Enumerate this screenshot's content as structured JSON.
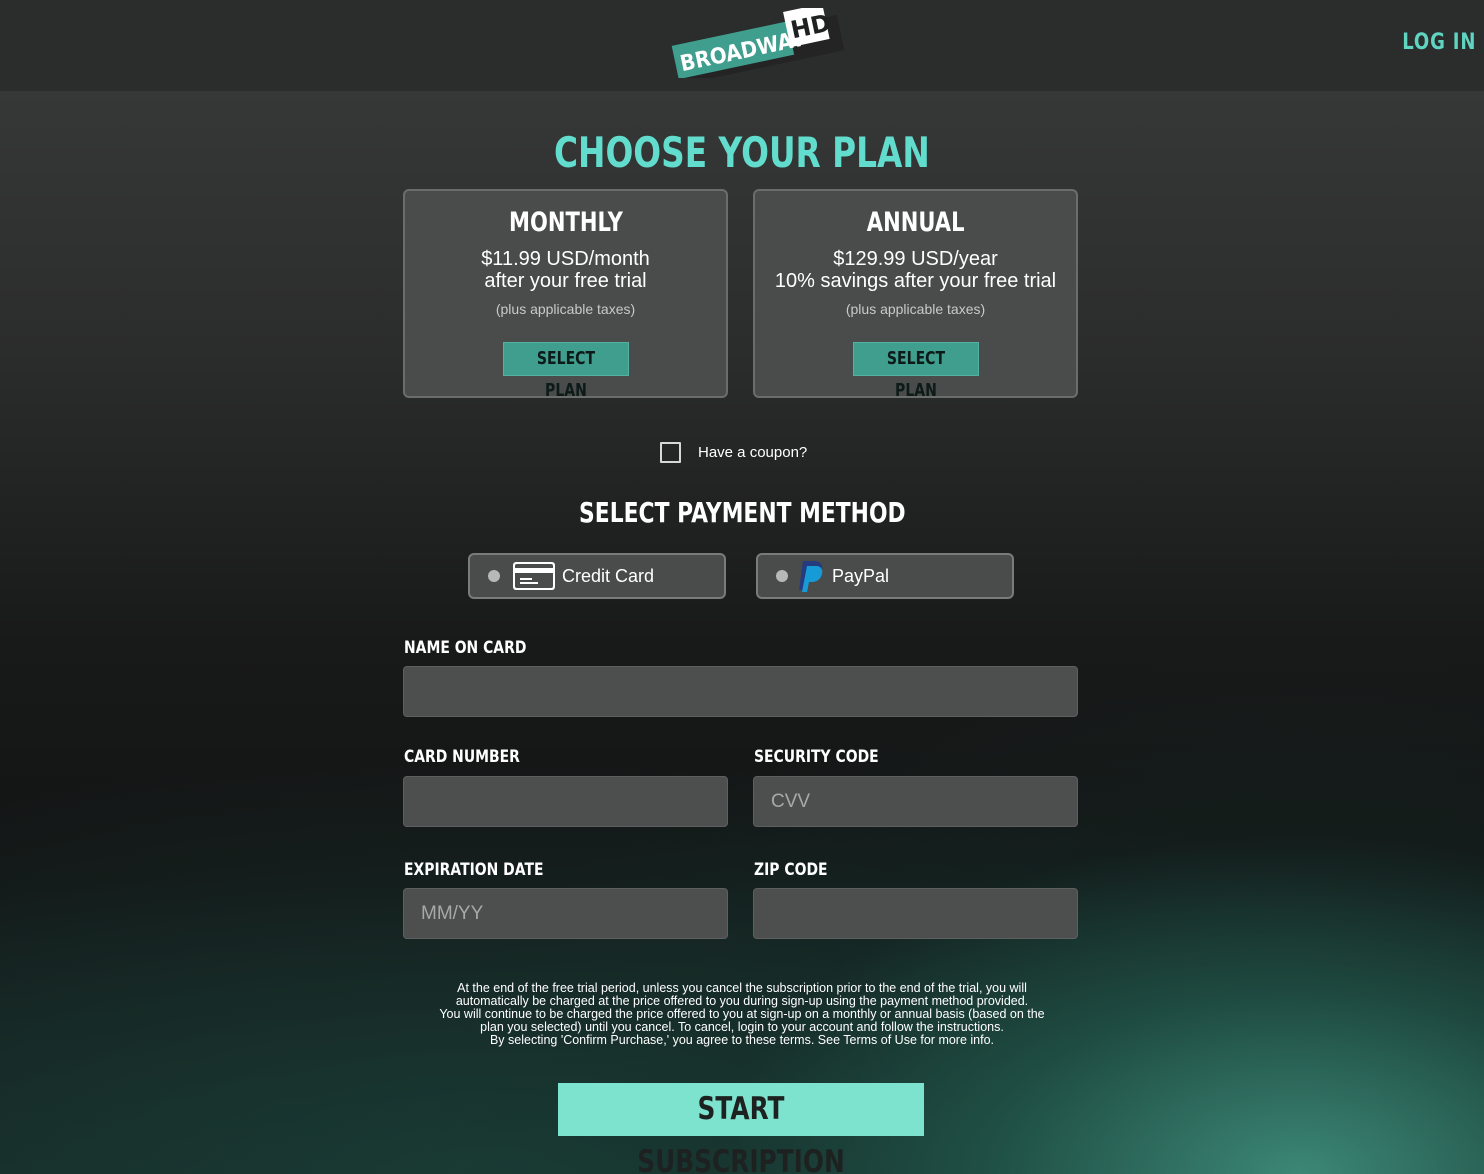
{
  "header": {
    "logo_text": "BROADWAY",
    "logo_badge": "HD",
    "login_label": "LOG IN"
  },
  "main": {
    "title": "CHOOSE YOUR PLAN",
    "plans": [
      {
        "name": "MONTHLY",
        "price_line1": "$11.99 USD/month",
        "price_line2": "after your free trial",
        "tax_note": "(plus applicable taxes)",
        "button_label": "SELECT PLAN"
      },
      {
        "name": "ANNUAL",
        "price_line1": "$129.99 USD/year",
        "price_line2": "10% savings after your free trial",
        "tax_note": "(plus applicable taxes)",
        "button_label": "SELECT PLAN"
      }
    ],
    "coupon_label": "Have a coupon?",
    "coupon_checked": false
  },
  "payment": {
    "title": "SELECT PAYMENT METHOD",
    "methods": [
      {
        "label": "Credit Card",
        "icon": "credit-card-icon",
        "selected": false
      },
      {
        "label": "PayPal",
        "icon": "paypal-icon",
        "selected": false
      }
    ]
  },
  "form": {
    "name_on_card": {
      "label": "NAME ON CARD",
      "value": "",
      "placeholder": ""
    },
    "card_number": {
      "label": "CARD NUMBER",
      "value": "",
      "placeholder": ""
    },
    "security_code": {
      "label": "SECURITY CODE",
      "value": "",
      "placeholder": "CVV"
    },
    "expiration_date": {
      "label": "EXPIRATION DATE",
      "value": "",
      "placeholder": "MM/YY"
    },
    "zip_code": {
      "label": "ZIP CODE",
      "value": "",
      "placeholder": ""
    }
  },
  "legal": {
    "lines": [
      "At the end of the free trial period, unless you cancel the subscription prior to the end of the trial, you will",
      "automatically be charged at the price offered to you during sign-up using the payment method provided.",
      "You will continue to be charged the price offered to you at sign-up on a monthly or annual basis (based on the",
      "plan you selected) until you cancel. To cancel, login to your account and follow the instructions.",
      "By selecting 'Confirm Purchase,' you agree to these terms. See Terms of Use for more info."
    ]
  },
  "cta": {
    "start_label": "START SUBSCRIPTION"
  },
  "colors": {
    "accent_teal": "#62dccc",
    "button_teal": "#3f9e8e",
    "cta_mint": "#7de3cf",
    "card_bg": "#4a4b4b",
    "logo_green": "#3f9e8e"
  }
}
